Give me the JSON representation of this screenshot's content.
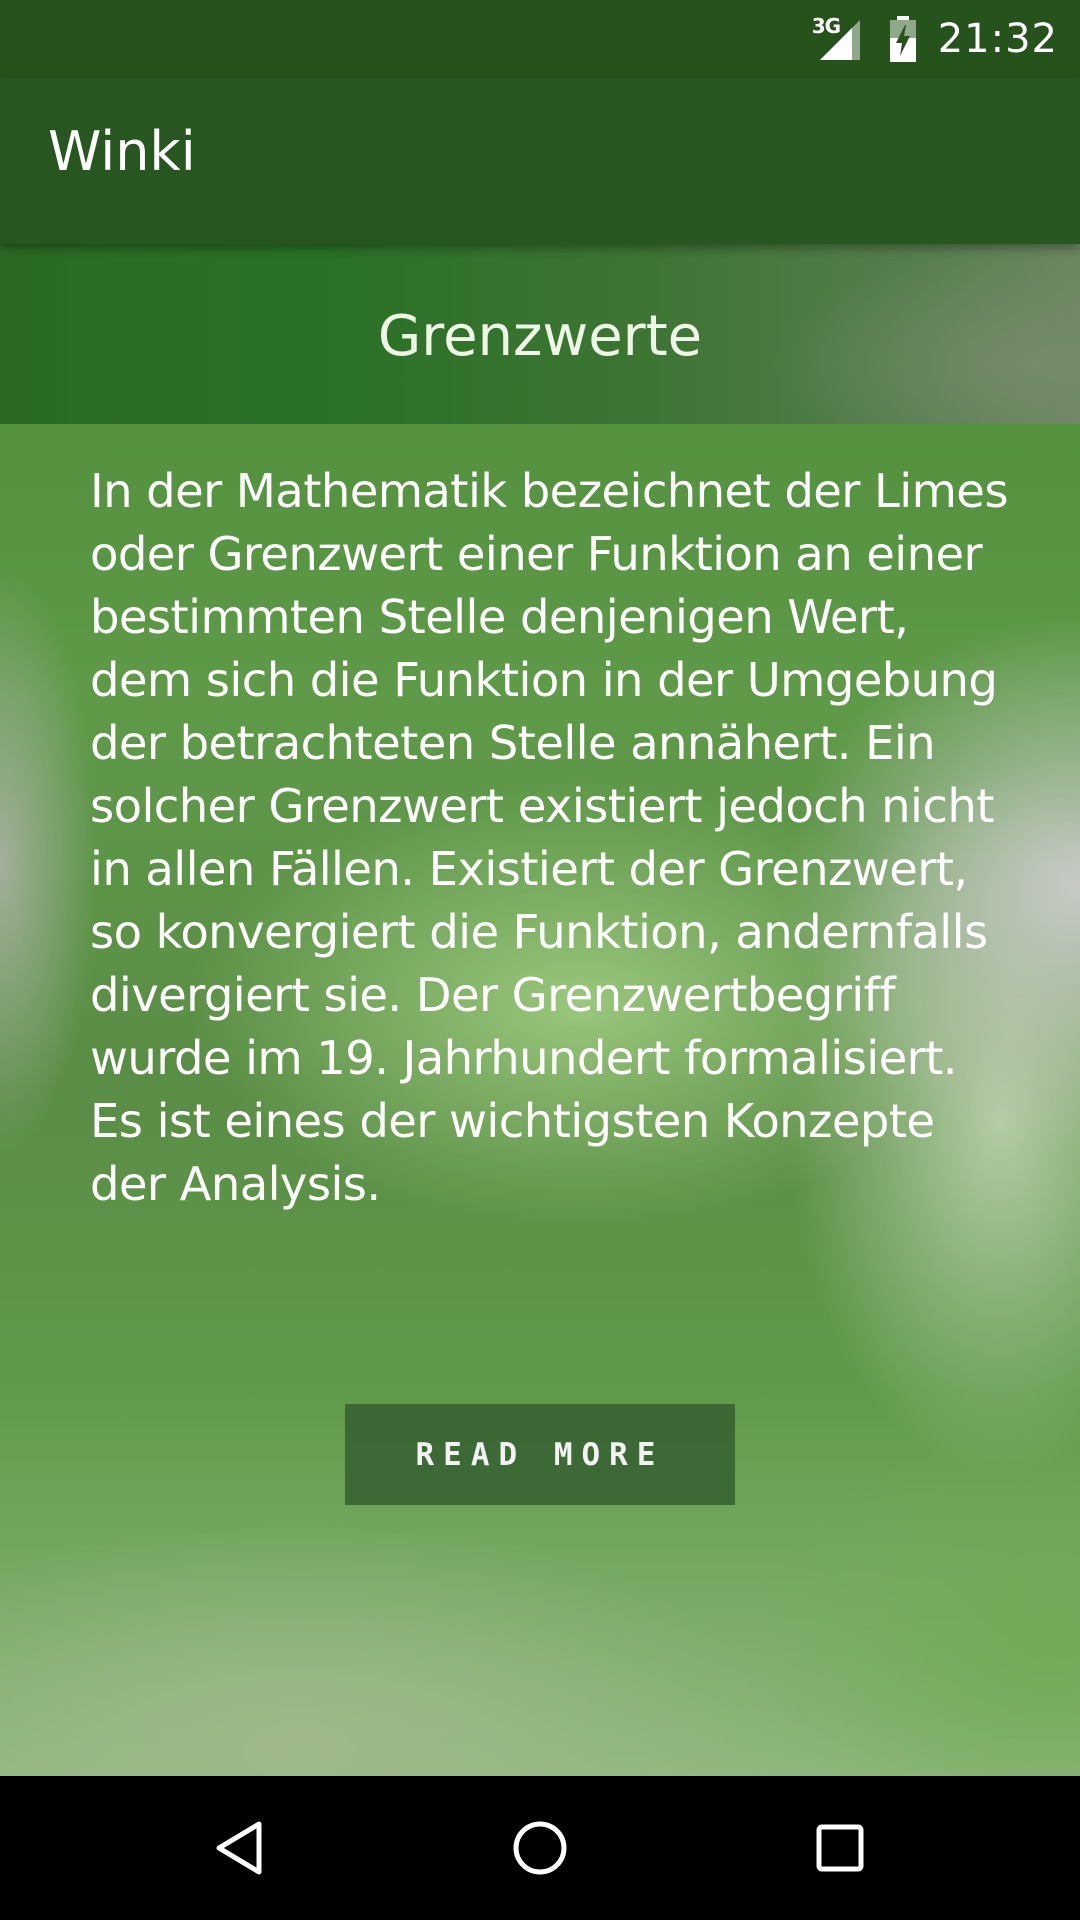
{
  "status_bar": {
    "network_label": "3G",
    "time": "21:32",
    "icons": [
      "signal-icon",
      "battery-charging-icon"
    ]
  },
  "app_bar": {
    "title": "Winki"
  },
  "article": {
    "title": "Grenzwerte",
    "body": "In der Mathematik bezeichnet der Limes oder Grenzwert einer Funktion an einer bestimmten Stelle denjenigen Wert, dem sich die Funktion in der Umgebung der betrachteten Stelle annähert. Ein solcher Grenzwert existiert jedoch nicht in allen Fällen. Existiert der Grenzwert, so konvergiert die Funktion, andernfalls divergiert sie. Der Grenzwertbegriff wurde im 19. Jahrhundert formalisiert. Es ist eines der wichtigsten Konzepte der Analysis.",
    "read_more_label": "READ MORE"
  },
  "nav_bar": {
    "icons": [
      "back-icon",
      "home-icon",
      "recents-icon"
    ]
  },
  "colors": {
    "status_bar": "#26521c",
    "app_bar": "#275620",
    "content_green": "#5e9a48",
    "button_bg": "#3a6434",
    "nav_bar": "#000000",
    "text": "#ffffff"
  }
}
